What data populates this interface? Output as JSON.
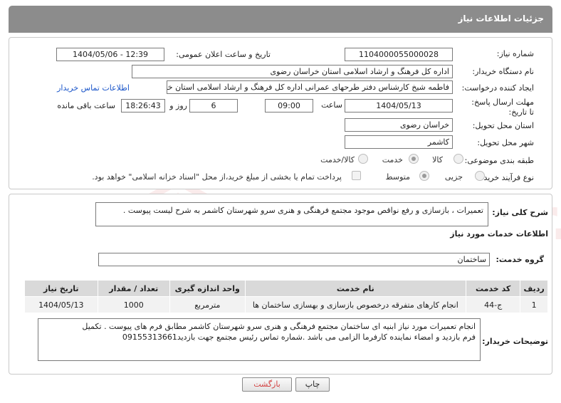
{
  "header": {
    "title": "جزئیات اطلاعات نیاز"
  },
  "fields": {
    "need_number_label": "شماره نیاز:",
    "need_number": "1104000055000028",
    "announce_label": "تاریخ و ساعت اعلان عمومی:",
    "announce_value": "1404/05/06 - 12:39",
    "buyer_org_label": "نام دستگاه خریدار:",
    "buyer_org": "اداره کل فرهنگ و ارشاد اسلامی استان خراسان رضوی",
    "creator_label": "ایجاد کننده درخواست:",
    "creator": "فاطمه شیخ کارشناس دفتر طرحهای عمرانی اداره کل فرهنگ و ارشاد اسلامی استان خراسان رضوی",
    "contact_link": "اطلاعات تماس خریدار",
    "deadline_label": "مهلت ارسال پاسخ: تا تاریخ:",
    "deadline_date": "1404/05/13",
    "time_label": "ساعت",
    "deadline_time": "09:00",
    "days_value": "6",
    "days_label": "روز و",
    "remaining_time": "18:26:43",
    "remaining_label": "ساعت باقی مانده",
    "province_label": "استان محل تحویل:",
    "province": "خراسان رضوی",
    "city_label": "شهر محل تحویل:",
    "city": "کاشمر",
    "category_label": "طبقه بندی موضوعی:",
    "category_options": [
      "کالا",
      "خدمت",
      "کالا/خدمت"
    ],
    "category_selected": "خدمت",
    "process_label": "نوع فرآیند خرید :",
    "process_options": [
      "جزیی",
      "متوسط"
    ],
    "process_selected": "متوسط",
    "treasury_note": "پرداخت تمام یا بخشی از مبلغ خرید،از محل \"اسناد خزانه اسلامی\" خواهد بود."
  },
  "description": {
    "label": "شرح کلی نیاز:",
    "text": "تعمیرات ، بازسازی و رفع نواقص موجود مجتمع فرهنگی و هنری سرو شهرستان کاشمر به شرح لیست پیوست ."
  },
  "services": {
    "section_title": "اطلاعات خدمات مورد نیاز",
    "group_label": "گروه خدمت:",
    "group_value": "ساختمان",
    "columns": [
      "ردیف",
      "کد خدمت",
      "نام خدمت",
      "واحد اندازه گیری",
      "تعداد / مقدار",
      "تاریخ نیاز"
    ],
    "rows": [
      {
        "row": "1",
        "code": "ج-44",
        "name": "انجام کارهای متفرقه درخصوص بازسازی و بهسازی ساختمان ها",
        "unit": "مترمربع",
        "qty": "1000",
        "date": "1404/05/13"
      }
    ]
  },
  "buyer_notes": {
    "label": "توضیحات خریدار:",
    "line1": "انجام تعمیرات مورد نیاز ابنیه ای ساختمان مجتمع فرهنگی و هنری  سرو شهرستان کاشمر مطابق فرم های پیوست . تکمیل",
    "line2": "فرم بازدید و امضاء نماینده کارفرما الزامی می باشد .شماره تماس رئیس مجتمع جهت بازدید09155313661"
  },
  "buttons": {
    "print": "چاپ",
    "back": "بازگشت"
  },
  "watermark": "AriaTender.neT",
  "colors": {
    "header": "#8c8c8c",
    "link": "#1a55c9",
    "watermark": "#d23c3c"
  }
}
